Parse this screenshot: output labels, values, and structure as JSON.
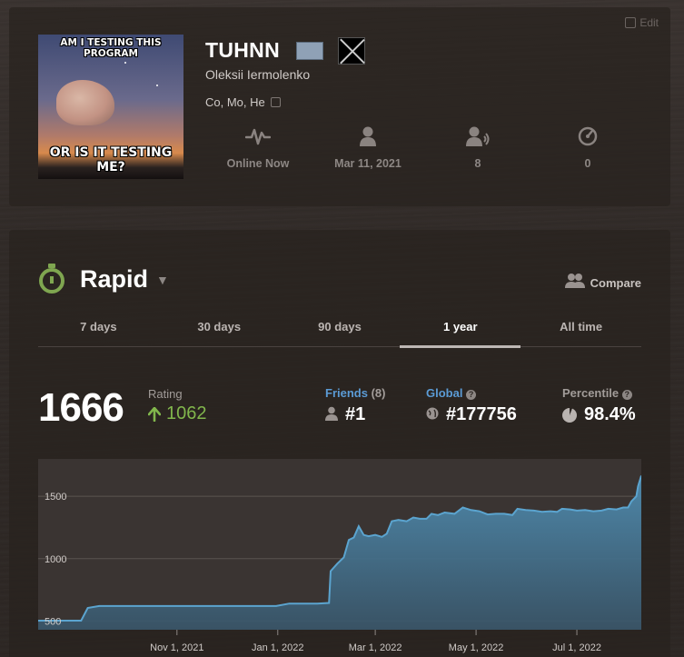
{
  "profile": {
    "edit_label": "Edit",
    "avatar": {
      "caption_top": "AM I TESTING THIS PROGRAM",
      "caption_bottom": "OR IS IT TESTING ME?"
    },
    "username": "TUHNN",
    "real_name": "Oleksii Iermolenko",
    "location": "Co, Mo, He",
    "stats": [
      {
        "icon": "activity-icon",
        "value": "Online Now"
      },
      {
        "icon": "person-icon",
        "value": "Mar 11, 2021"
      },
      {
        "icon": "friends-icon",
        "value": "8"
      },
      {
        "icon": "views-icon",
        "value": "0"
      }
    ]
  },
  "stats": {
    "game_type": "Rapid",
    "compare_label": "Compare",
    "tabs": [
      "7 days",
      "30 days",
      "90 days",
      "1 year",
      "All time"
    ],
    "active_tab": "1 year",
    "rating": "1666",
    "rating_label": "Rating",
    "rating_change": "1062",
    "friends": {
      "label": "Friends",
      "count": "(8)",
      "value": "#1"
    },
    "global": {
      "label": "Global",
      "value": "#177756"
    },
    "percentile": {
      "label": "Percentile",
      "value": "98.4%"
    }
  },
  "colors": {
    "accent_green": "#81b64c",
    "link_blue": "#5b9bd5",
    "chart_line": "#5ba4cf"
  },
  "chart_data": {
    "type": "area",
    "title": "",
    "y_ticks": [
      500,
      1000,
      1500
    ],
    "ylim": [
      430,
      1800
    ],
    "x_ticks": [
      {
        "label": "Nov 1, 2021",
        "date": "2021-11-01"
      },
      {
        "label": "Jan 1, 2022",
        "date": "2022-01-01"
      },
      {
        "label": "Mar 1, 2022",
        "date": "2022-03-01"
      },
      {
        "label": "May 1, 2022",
        "date": "2022-05-01"
      },
      {
        "label": "Jul 1, 2022",
        "date": "2022-07-01"
      }
    ],
    "xlim": [
      "2021-08-09",
      "2022-08-09"
    ],
    "grid": true,
    "series": [
      {
        "points": [
          [
            "2021-08-09",
            503
          ],
          [
            "2021-09-04",
            503
          ],
          [
            "2021-09-08",
            605
          ],
          [
            "2021-09-15",
            620
          ],
          [
            "2021-12-24",
            620
          ],
          [
            "2021-12-31",
            620
          ],
          [
            "2022-01-08",
            640
          ],
          [
            "2022-01-25",
            640
          ],
          [
            "2022-02-01",
            645
          ],
          [
            "2022-02-02",
            900
          ],
          [
            "2022-02-06",
            960
          ],
          [
            "2022-02-10",
            1010
          ],
          [
            "2022-02-13",
            1150
          ],
          [
            "2022-02-16",
            1170
          ],
          [
            "2022-02-19",
            1260
          ],
          [
            "2022-02-22",
            1190
          ],
          [
            "2022-02-25",
            1180
          ],
          [
            "2022-03-01",
            1190
          ],
          [
            "2022-03-05",
            1175
          ],
          [
            "2022-03-08",
            1200
          ],
          [
            "2022-03-11",
            1300
          ],
          [
            "2022-03-15",
            1310
          ],
          [
            "2022-03-20",
            1300
          ],
          [
            "2022-03-24",
            1330
          ],
          [
            "2022-03-28",
            1320
          ],
          [
            "2022-04-01",
            1320
          ],
          [
            "2022-04-04",
            1360
          ],
          [
            "2022-04-08",
            1350
          ],
          [
            "2022-04-12",
            1370
          ],
          [
            "2022-04-18",
            1360
          ],
          [
            "2022-04-23",
            1410
          ],
          [
            "2022-04-28",
            1390
          ],
          [
            "2022-05-03",
            1380
          ],
          [
            "2022-05-08",
            1355
          ],
          [
            "2022-05-13",
            1360
          ],
          [
            "2022-05-18",
            1360
          ],
          [
            "2022-05-23",
            1350
          ],
          [
            "2022-05-26",
            1400
          ],
          [
            "2022-05-31",
            1390
          ],
          [
            "2022-06-05",
            1385
          ],
          [
            "2022-06-10",
            1375
          ],
          [
            "2022-06-15",
            1380
          ],
          [
            "2022-06-19",
            1375
          ],
          [
            "2022-06-22",
            1400
          ],
          [
            "2022-06-27",
            1395
          ],
          [
            "2022-07-01",
            1385
          ],
          [
            "2022-07-06",
            1390
          ],
          [
            "2022-07-11",
            1380
          ],
          [
            "2022-07-16",
            1385
          ],
          [
            "2022-07-20",
            1400
          ],
          [
            "2022-07-25",
            1395
          ],
          [
            "2022-07-29",
            1410
          ],
          [
            "2022-08-01",
            1410
          ],
          [
            "2022-08-03",
            1460
          ],
          [
            "2022-08-06",
            1500
          ],
          [
            "2022-08-07",
            1580
          ],
          [
            "2022-08-09",
            1666
          ]
        ]
      }
    ]
  }
}
